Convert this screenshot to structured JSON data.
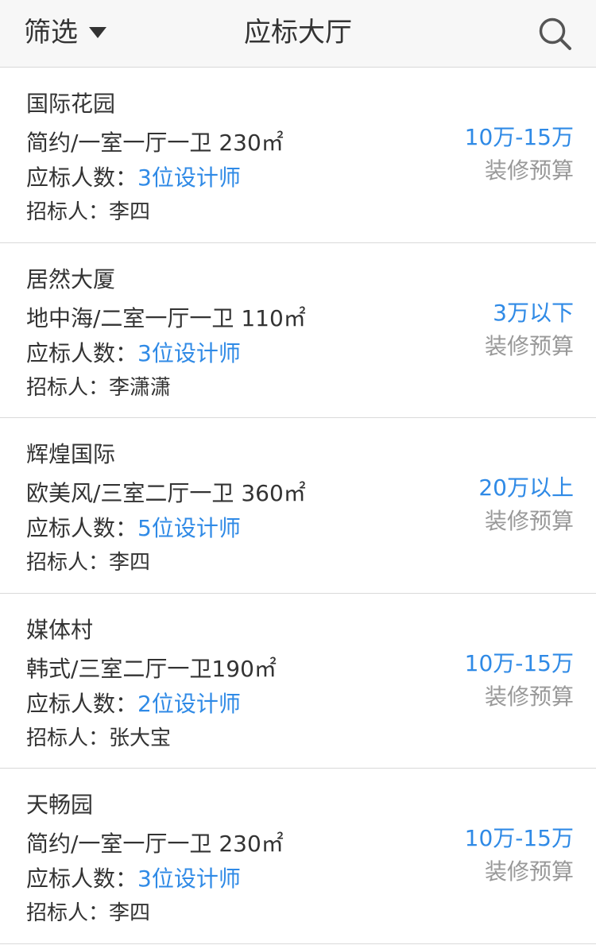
{
  "header": {
    "filter_label": "筛选",
    "title": "应标大厅",
    "filter_icon": "caret-down-icon",
    "search_icon": "search-icon"
  },
  "colors": {
    "accent": "#2f8ae6",
    "text": "#333333",
    "muted": "#999999",
    "divider": "#d9d9d9",
    "header_bg": "#f7f7f7"
  },
  "bids": [
    {
      "name": "国际花园",
      "spec": "简约/一室一厅一卫 230㎡",
      "bidders_label": "应标人数：",
      "bidders_value": "3位设计师",
      "inviter": "招标人：李四",
      "budget": "10万-15万",
      "budget_label": "装修预算"
    },
    {
      "name": "居然大厦",
      "spec": "地中海/二室一厅一卫 110㎡",
      "bidders_label": "应标人数：",
      "bidders_value": "3位设计师",
      "inviter": "招标人：李潇潇",
      "budget": "3万以下",
      "budget_label": "装修预算"
    },
    {
      "name": "辉煌国际",
      "spec": "欧美风/三室二厅一卫 360㎡",
      "bidders_label": "应标人数：",
      "bidders_value": "5位设计师",
      "inviter": "招标人：李四",
      "budget": "20万以上",
      "budget_label": "装修预算"
    },
    {
      "name": "媒体村",
      "spec": "韩式/三室二厅一卫190㎡",
      "bidders_label": "应标人数：",
      "bidders_value": "2位设计师",
      "inviter": "招标人：张大宝",
      "budget": "10万-15万",
      "budget_label": "装修预算"
    },
    {
      "name": "天畅园",
      "spec": "简约/一室一厅一卫 230㎡",
      "bidders_label": "应标人数：",
      "bidders_value": "3位设计师",
      "inviter": "招标人：李四",
      "budget": "10万-15万",
      "budget_label": "装修预算"
    }
  ]
}
